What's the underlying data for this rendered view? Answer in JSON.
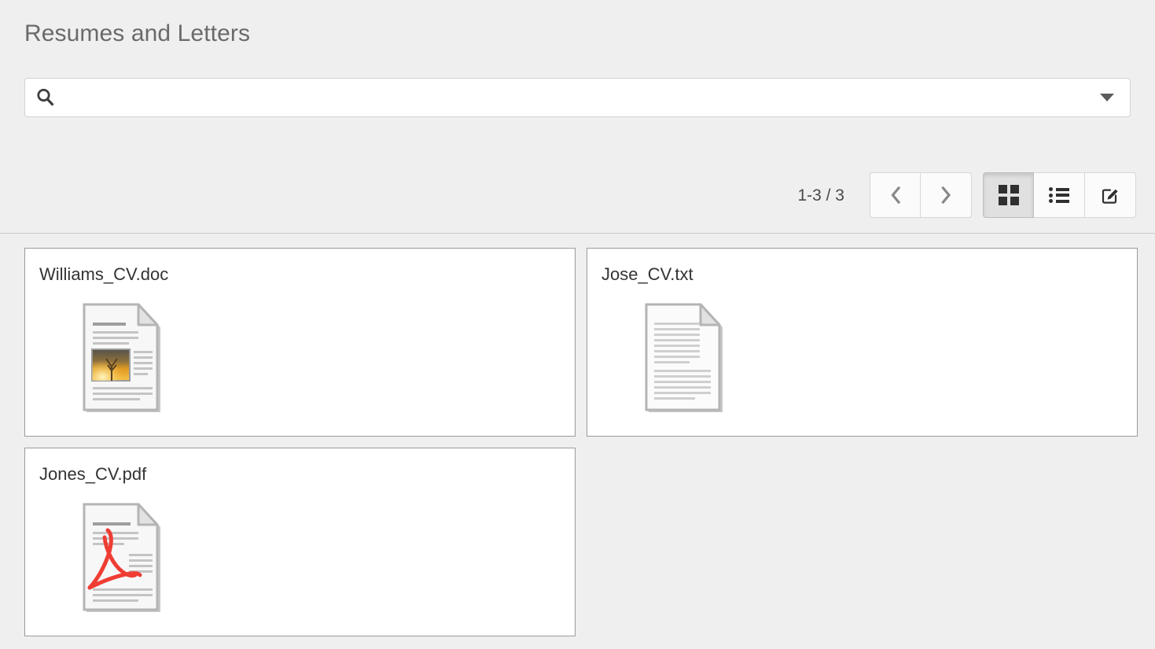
{
  "header": {
    "title": "Resumes and Letters"
  },
  "search": {
    "icon": "search-icon",
    "value": "",
    "placeholder": "",
    "dropdown_icon": "caret-down-icon"
  },
  "toolbar": {
    "pager_label": "1-3 / 3",
    "prev_button": {
      "icon": "chevron-left-icon",
      "label": ""
    },
    "next_button": {
      "icon": "chevron-right-icon",
      "label": ""
    },
    "view_modes": [
      {
        "name": "grid-view",
        "icon": "grid-icon",
        "label": "",
        "active": true
      },
      {
        "name": "list-view",
        "icon": "list-icon",
        "label": "",
        "active": false
      },
      {
        "name": "edit-view",
        "icon": "edit-pencil-icon",
        "label": "",
        "active": false
      }
    ]
  },
  "files": [
    {
      "name": "Williams_CV.doc",
      "type": "doc",
      "icon": "document-with-image-icon"
    },
    {
      "name": "Jose_CV.txt",
      "type": "txt",
      "icon": "text-document-icon"
    },
    {
      "name": "Jones_CV.pdf",
      "type": "pdf",
      "icon": "pdf-document-icon"
    }
  ],
  "colors": {
    "page_background": "#efefef",
    "card_background": "#ffffff",
    "title_text": "#6a6a6a",
    "body_text": "#333333",
    "pdf_accent": "#ef3d34",
    "doc_image_accent": "#f0a81e",
    "active_button": "#e0e0e0"
  }
}
